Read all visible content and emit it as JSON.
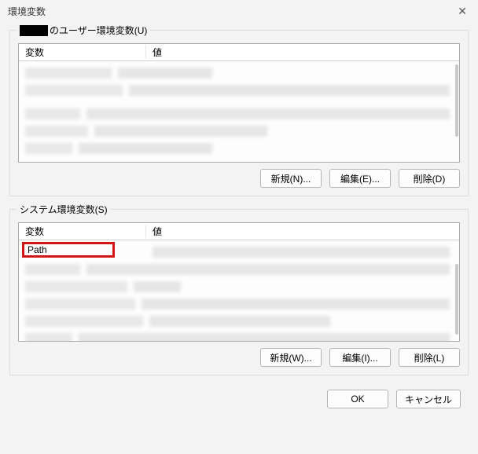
{
  "title": "環境変数",
  "user_group": {
    "legend_suffix": "のユーザー環境変数(U)",
    "col_var": "変数",
    "col_val": "値",
    "buttons": {
      "new": "新規(N)...",
      "edit": "編集(E)...",
      "delete": "削除(D)"
    }
  },
  "system_group": {
    "legend": "システム環境変数(S)",
    "col_var": "変数",
    "col_val": "値",
    "highlighted_var": "Path",
    "buttons": {
      "new": "新規(W)...",
      "edit": "編集(I)...",
      "delete": "削除(L)"
    }
  },
  "footer": {
    "ok": "OK",
    "cancel": "キャンセル"
  }
}
